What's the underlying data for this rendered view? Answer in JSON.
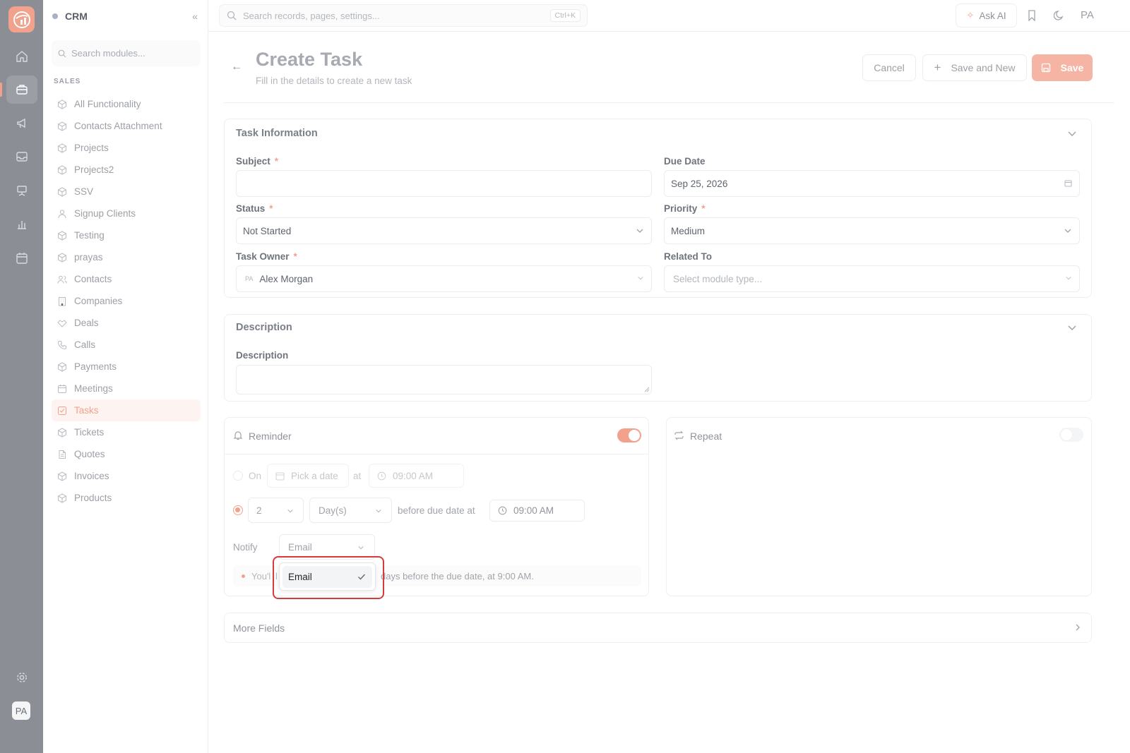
{
  "app": {
    "title": "CRM"
  },
  "rail": {
    "avatar": "PA"
  },
  "sidebar": {
    "search_placeholder": "Search modules...",
    "section": "SALES",
    "items": [
      {
        "label": "All Functionality",
        "icon": "cube-icon"
      },
      {
        "label": "Contacts Attachment",
        "icon": "cube-icon"
      },
      {
        "label": "Projects",
        "icon": "cube-icon"
      },
      {
        "label": "Projects2",
        "icon": "cube-icon"
      },
      {
        "label": "SSV",
        "icon": "cube-icon"
      },
      {
        "label": "Signup Clients",
        "icon": "user-icon"
      },
      {
        "label": "Testing",
        "icon": "cube-icon"
      },
      {
        "label": "prayas",
        "icon": "cube-icon"
      },
      {
        "label": "Contacts",
        "icon": "users-icon"
      },
      {
        "label": "Companies",
        "icon": "building-icon"
      },
      {
        "label": "Deals",
        "icon": "handshake-icon"
      },
      {
        "label": "Calls",
        "icon": "phone-icon"
      },
      {
        "label": "Payments",
        "icon": "cube-icon"
      },
      {
        "label": "Meetings",
        "icon": "calendar-icon"
      },
      {
        "label": "Tasks",
        "icon": "checkbox-icon",
        "active": true
      },
      {
        "label": "Tickets",
        "icon": "cube-icon"
      },
      {
        "label": "Quotes",
        "icon": "document-icon"
      },
      {
        "label": "Invoices",
        "icon": "cube-icon"
      },
      {
        "label": "Products",
        "icon": "cube-icon"
      }
    ]
  },
  "topbar": {
    "search_placeholder": "Search records, pages, settings...",
    "shortcut": "Ctrl+K",
    "ask_ai": "Ask AI",
    "user_initials": "PA"
  },
  "page": {
    "title": "Create Task",
    "subtitle": "Fill in the details to create a new task",
    "cancel": "Cancel",
    "save_and_new": "Save and New",
    "save": "Save"
  },
  "task_info": {
    "title": "Task Information",
    "subject_label": "Subject",
    "subject_value": "",
    "due_date_label": "Due Date",
    "due_date_value": "Sep 25, 2026",
    "status_label": "Status",
    "status_value": "Not Started",
    "priority_label": "Priority",
    "priority_value": "Medium",
    "owner_label": "Task Owner",
    "owner_initials": "PA",
    "owner_value": "Alex Morgan",
    "related_label": "Related To",
    "related_placeholder": "Select module type..."
  },
  "description": {
    "title": "Description",
    "field_label": "Description",
    "value": ""
  },
  "reminder": {
    "title": "Reminder",
    "enabled": true,
    "on_label": "On",
    "pick_date_placeholder": "Pick a date",
    "at_label": "at",
    "on_time": "09:00 AM",
    "before_count": "2",
    "before_unit": "Day(s)",
    "before_text": "before due date at",
    "before_time": "09:00 AM",
    "notify_label": "Notify",
    "notify_value": "Email",
    "hint_prefix": "You'l",
    "hint_fragment": "l",
    "hint_suffix": "days before the due date, at 9:00 AM.",
    "notify_options": [
      {
        "label": "Email",
        "selected": true
      }
    ]
  },
  "repeat": {
    "title": "Repeat",
    "enabled": false
  },
  "more_fields": {
    "title": "More Fields"
  },
  "colors": {
    "accent": "#f2a28c",
    "rail": "#8b8e95",
    "highlight": "#d63a3a"
  }
}
